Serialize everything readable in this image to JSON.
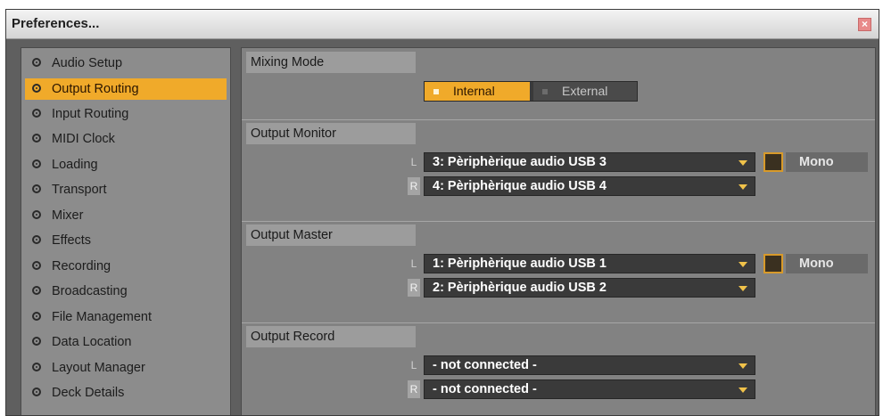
{
  "window": {
    "title": "Preferences...",
    "close_glyph": "×"
  },
  "sidebar": {
    "items": [
      {
        "label": "Audio Setup",
        "active": false
      },
      {
        "label": "Output Routing",
        "active": true
      },
      {
        "label": "Input Routing",
        "active": false
      },
      {
        "label": "MIDI Clock",
        "active": false
      },
      {
        "label": "Loading",
        "active": false
      },
      {
        "label": "Transport",
        "active": false
      },
      {
        "label": "Mixer",
        "active": false
      },
      {
        "label": "Effects",
        "active": false
      },
      {
        "label": "Recording",
        "active": false
      },
      {
        "label": "Broadcasting",
        "active": false
      },
      {
        "label": "File Management",
        "active": false
      },
      {
        "label": "Data Location",
        "active": false
      },
      {
        "label": "Layout Manager",
        "active": false
      },
      {
        "label": "Deck Details",
        "active": false
      }
    ]
  },
  "mixing_mode": {
    "label": "Mixing Mode",
    "options": [
      "Internal",
      "External"
    ],
    "selected": "Internal"
  },
  "output_monitor": {
    "label": "Output Monitor",
    "left_channel": "L",
    "right_channel": "R",
    "left_value": "3: Pèriphèrique audio USB 3",
    "right_value": "4: Pèriphèrique audio USB 4",
    "mono_label": "Mono",
    "mono_checked": false
  },
  "output_master": {
    "label": "Output Master",
    "left_channel": "L",
    "right_channel": "R",
    "left_value": "1: Pèriphèrique audio USB 1",
    "right_value": "2: Pèriphèrique audio USB 2",
    "mono_label": "Mono",
    "mono_checked": false
  },
  "output_record": {
    "label": "Output Record",
    "left_channel": "L",
    "right_channel": "R",
    "left_value": "- not connected -",
    "right_value": "- not connected -"
  },
  "colors": {
    "accent": "#f0aa2a",
    "panel": "#828282",
    "sidebar": "#8c8c8c",
    "dropdown": "#3a3a3a"
  }
}
